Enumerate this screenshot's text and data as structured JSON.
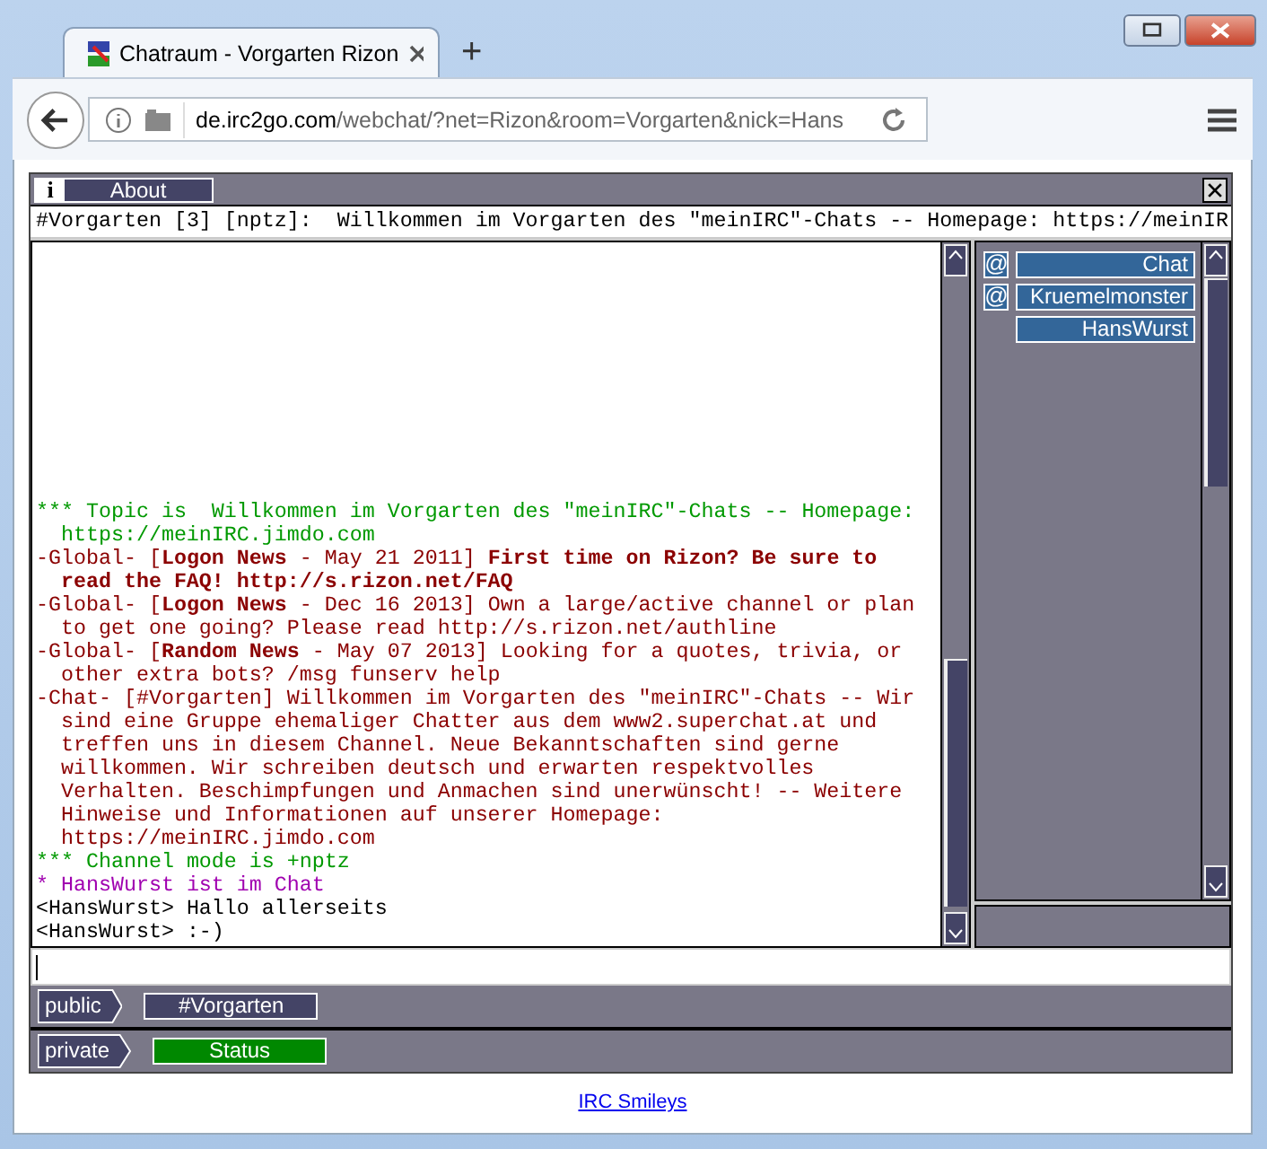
{
  "browser": {
    "tab_title": "Chatraum - Vorgarten Rizon",
    "new_tab": "+",
    "url_host": "de.irc2go.com",
    "url_path": "/webchat/?net=Rizon&room=Vorgarten&nick=Hans"
  },
  "menu": {
    "info": "i",
    "about": "About"
  },
  "topic": "#Vorgarten [3] [nptz]:  Willkommen im Vorgarten des \"meinIRC\"-Chats -- Homepage: https://meinIR",
  "messages": [
    {
      "kind": "topic",
      "text": "*** Topic is  Willkommen im Vorgarten des \"meinIRC\"-Chats -- Homepage: https://meinIRC.jimdo.com"
    },
    {
      "kind": "notice",
      "text": "-Global- [**Logon News** - May 21 2011] **First time on Rizon? Be sure to read the FAQ! http://s.rizon.net/FAQ**"
    },
    {
      "kind": "notice",
      "text": "-Global- [**Logon News** - Dec 16 2013] Own a large/active channel or plan to get one going? Please read http://s.rizon.net/authline"
    },
    {
      "kind": "notice",
      "text": "-Global- [**Random News** - May 07 2013] Looking for a quotes, trivia, or other extra bots? /msg funserv help"
    },
    {
      "kind": "notice",
      "text": "-Chat- [#Vorgarten] Willkommen im Vorgarten des \"meinIRC\"-Chats -- Wir sind eine Gruppe ehemaliger Chatter aus dem www2.superchat.at und treffen uns in diesem Channel. Neue Bekanntschaften sind gerne willkommen. Wir schreiben deutsch und erwarten respektvolles Verhalten. Beschimpfungen und Anmachen sind unerwünscht! -- Weitere Hinweise und Informationen auf unserer Homepage: https://meinIRC.jimdo.com"
    },
    {
      "kind": "topic",
      "text": "*** Channel mode is +nptz"
    },
    {
      "kind": "join",
      "text": "* HansWurst ist im Chat"
    },
    {
      "kind": "message",
      "text": "<HansWurst> Hallo allerseits"
    },
    {
      "kind": "message",
      "text": "<HansWurst> :-)"
    }
  ],
  "nicklist": [
    {
      "nick": "Chat",
      "op": true
    },
    {
      "nick": "Kruemelmonster",
      "op": true
    },
    {
      "nick": "HansWurst",
      "op": false
    }
  ],
  "op_symbol": "@",
  "window_groups": [
    {
      "label": "public",
      "tabs": [
        {
          "label": "#Vorgarten",
          "selected": false
        }
      ]
    },
    {
      "label": "private",
      "tabs": [
        {
          "label": "Status",
          "selected": true
        }
      ]
    }
  ],
  "footer_link": "IRC Smileys"
}
